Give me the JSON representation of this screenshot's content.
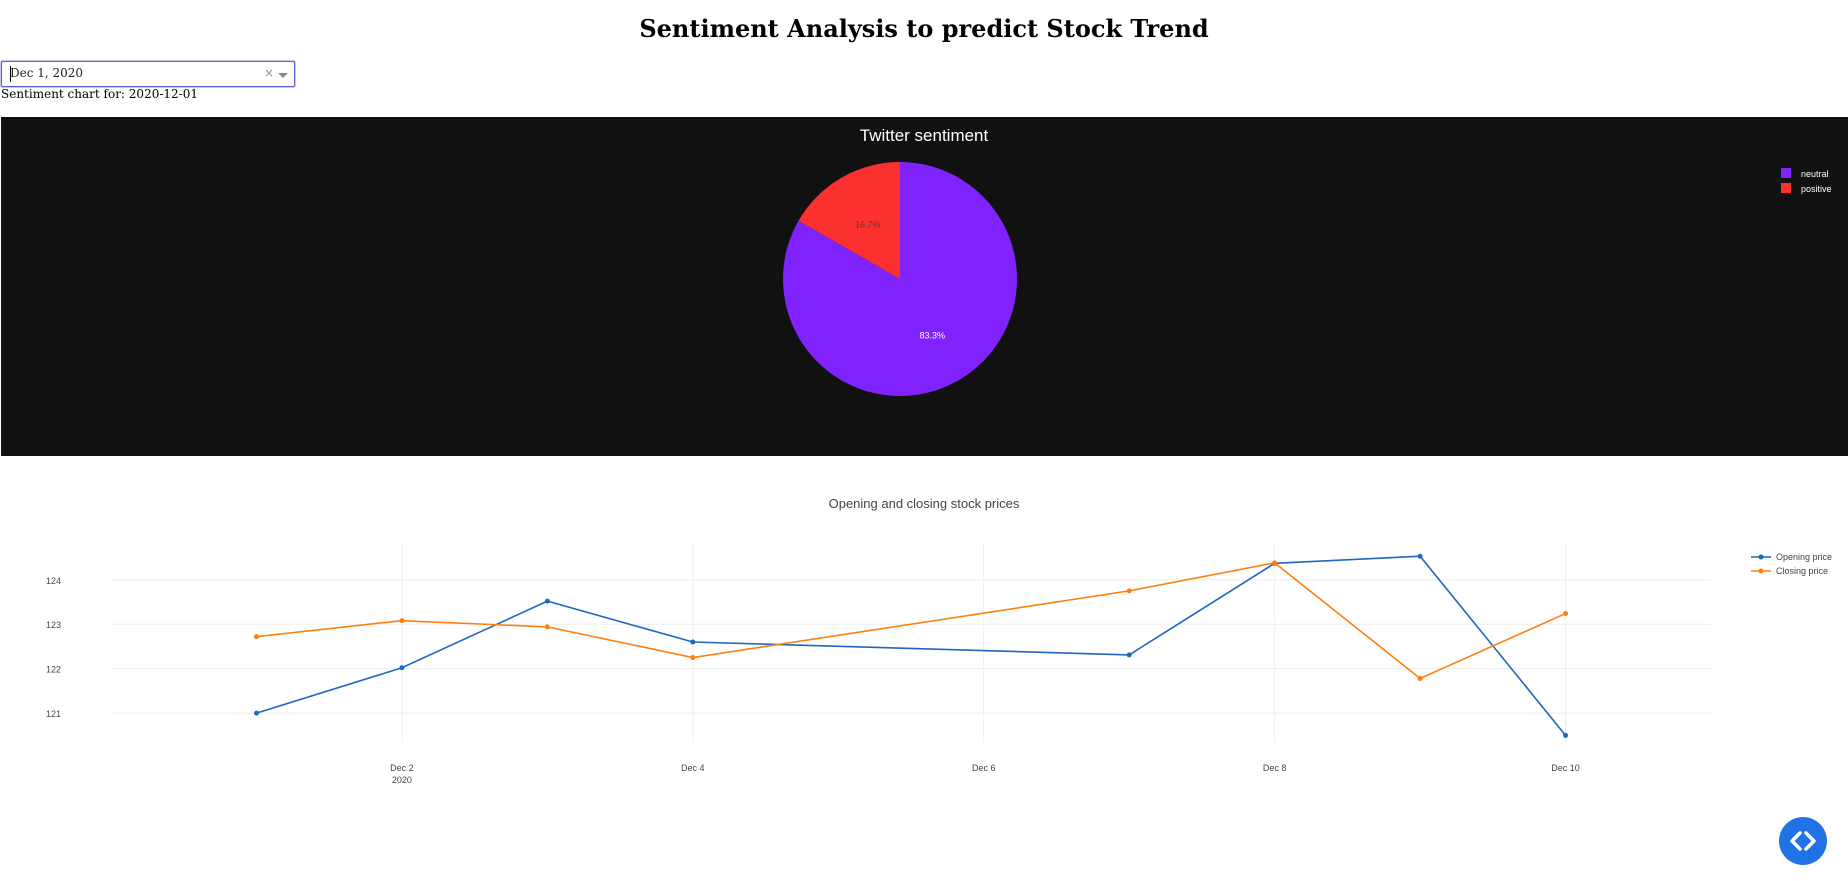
{
  "page": {
    "title": "Sentiment Analysis to predict Stock Trend",
    "subtitle_prefix": "Sentiment chart for: ",
    "subtitle_date": "2020-12-01"
  },
  "date_picker": {
    "value": "Dec 1, 2020",
    "clear_symbol": "×"
  },
  "chart_data": [
    {
      "type": "pie",
      "title": "Twitter sentiment",
      "labels": [
        "neutral",
        "positive"
      ],
      "values": [
        83.3,
        16.7
      ],
      "text_labels": [
        "83.3%",
        "16.7%"
      ],
      "colors": [
        "#7f22fd",
        "#fd3030"
      ],
      "background": "#111111",
      "legend_position": "top-right"
    },
    {
      "type": "line",
      "title": "Opening and closing stock prices",
      "x": [
        "2020-12-01",
        "2020-12-02",
        "2020-12-03",
        "2020-12-04",
        "2020-12-07",
        "2020-12-08",
        "2020-12-09",
        "2020-12-10"
      ],
      "series": [
        {
          "name": "Opening price",
          "color": "#1f68c1",
          "values": [
            121.0,
            122.02,
            123.52,
            122.6,
            122.31,
            124.37,
            124.53,
            120.5
          ]
        },
        {
          "name": "Closing price",
          "color": "#ff7f0e",
          "values": [
            122.72,
            123.08,
            122.94,
            122.25,
            123.75,
            124.38,
            121.78,
            123.24
          ]
        }
      ],
      "x_ticks": [
        "Dec 2",
        "Dec 4",
        "Dec 6",
        "Dec 8",
        "Dec 10"
      ],
      "x_tick_dates": [
        "2020-12-02",
        "2020-12-04",
        "2020-12-06",
        "2020-12-08",
        "2020-12-10"
      ],
      "x_sub_label": "2020",
      "y_ticks": [
        121,
        122,
        123,
        124
      ],
      "xlim": [
        "2020-11-30",
        "2020-12-11"
      ],
      "ylim": [
        120.35,
        124.85
      ],
      "grid": true,
      "legend_position": "top-right"
    }
  ]
}
